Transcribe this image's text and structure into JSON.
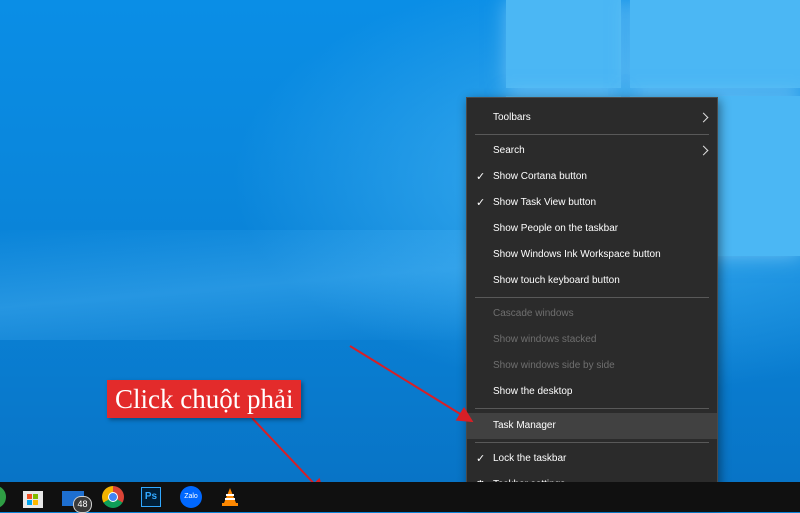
{
  "context_menu": {
    "items": [
      {
        "label": "Toolbars",
        "checked": false,
        "submenu": true,
        "enabled": true
      },
      {
        "label": "Search",
        "checked": false,
        "submenu": true,
        "enabled": true
      },
      {
        "label": "Show Cortana button",
        "checked": true,
        "enabled": true
      },
      {
        "label": "Show Task View button",
        "checked": true,
        "enabled": true
      },
      {
        "label": "Show People on the taskbar",
        "checked": false,
        "enabled": true
      },
      {
        "label": "Show Windows Ink Workspace button",
        "checked": false,
        "enabled": true
      },
      {
        "label": "Show touch keyboard button",
        "checked": false,
        "enabled": true
      },
      {
        "label": "Cascade windows",
        "checked": false,
        "enabled": false
      },
      {
        "label": "Show windows stacked",
        "checked": false,
        "enabled": false
      },
      {
        "label": "Show windows side by side",
        "checked": false,
        "enabled": false
      },
      {
        "label": "Show the desktop",
        "checked": false,
        "enabled": true
      },
      {
        "label": "Task Manager",
        "checked": false,
        "enabled": true,
        "highlighted": true
      },
      {
        "label": "Lock the taskbar",
        "checked": true,
        "enabled": true
      },
      {
        "label": "Taskbar settings",
        "checked": false,
        "enabled": true,
        "icon": "gear-icon"
      }
    ],
    "check_glyph": "✓",
    "gear_glyph": "⚙"
  },
  "annotation": {
    "text": "Click chuột phải",
    "color": "#e32b2b"
  },
  "taskbar": {
    "apps": [
      {
        "name": "microsoft-store-icon"
      },
      {
        "name": "mail-icon",
        "badge": "48"
      },
      {
        "name": "chrome-icon"
      },
      {
        "name": "photoshop-icon",
        "label": "Ps"
      },
      {
        "name": "zalo-icon",
        "label": "Zalo"
      },
      {
        "name": "vlc-icon"
      }
    ]
  },
  "colors": {
    "menu_bg": "#2b2b2b",
    "menu_highlight": "#414141",
    "taskbar_bg": "#101010",
    "desktop_blue": "#0a84d8"
  }
}
